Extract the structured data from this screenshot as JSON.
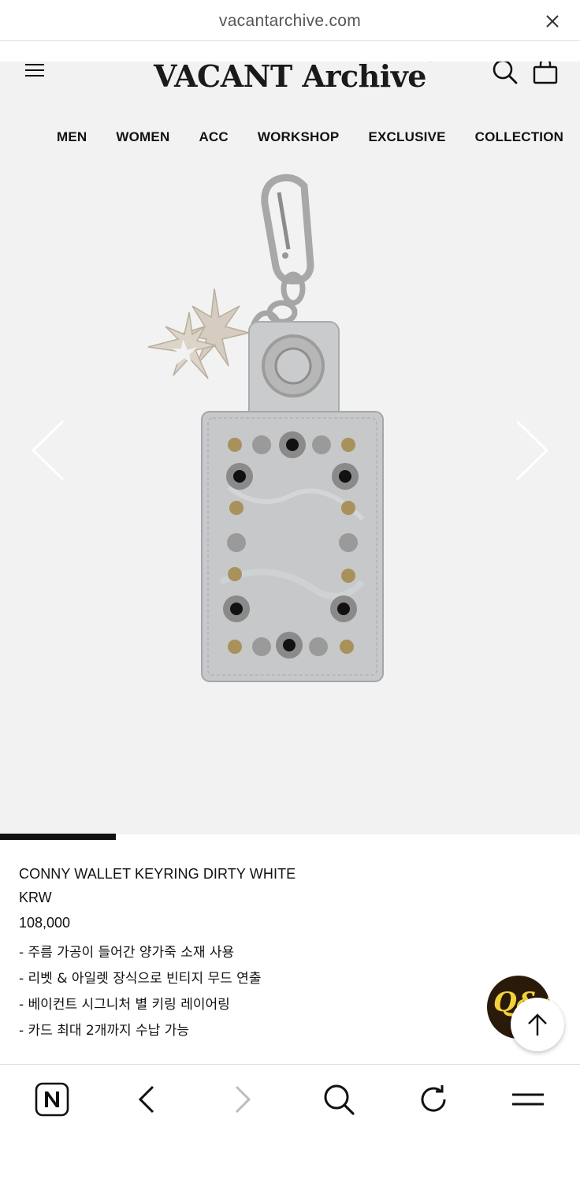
{
  "browser": {
    "url": "vacantarchive.com",
    "close_icon": "close-icon"
  },
  "site": {
    "logo_text": "VACANT Archive",
    "logo_star": "✦",
    "nav": [
      "MEN",
      "WOMEN",
      "ACC",
      "WORKSHOP",
      "EXCLUSIVE",
      "COLLECTION"
    ],
    "icons": [
      "menu-icon",
      "search-icon",
      "shopping-bag-icon",
      "chevron-left-icon",
      "chevron-right-icon"
    ]
  },
  "carousel": {
    "progress": 0.2
  },
  "product": {
    "name": "CONNY WALLET KEYRING DIRTY WHITE",
    "currency": "KRW",
    "price": "108,000",
    "bullets": [
      "- 주름 가공이 들어간 양가죽 소재 사용",
      "- 리벳 & 아일렛 장식으로 빈티지 무드 연출",
      "- 베이컨트 시그니처 별 키링 레이어링",
      "- 카드 최대 2개까지 수납 가능"
    ]
  },
  "floating": {
    "qna_label": "Q&A",
    "top_icon": "arrow-up-icon"
  },
  "toolbar": {
    "icons": [
      "naver-home-icon",
      "back-icon",
      "forward-icon",
      "search-icon",
      "refresh-icon",
      "menu-icon"
    ]
  },
  "colors": {
    "background": "#f2f2f2",
    "text": "#111111",
    "accent": "#111111"
  }
}
